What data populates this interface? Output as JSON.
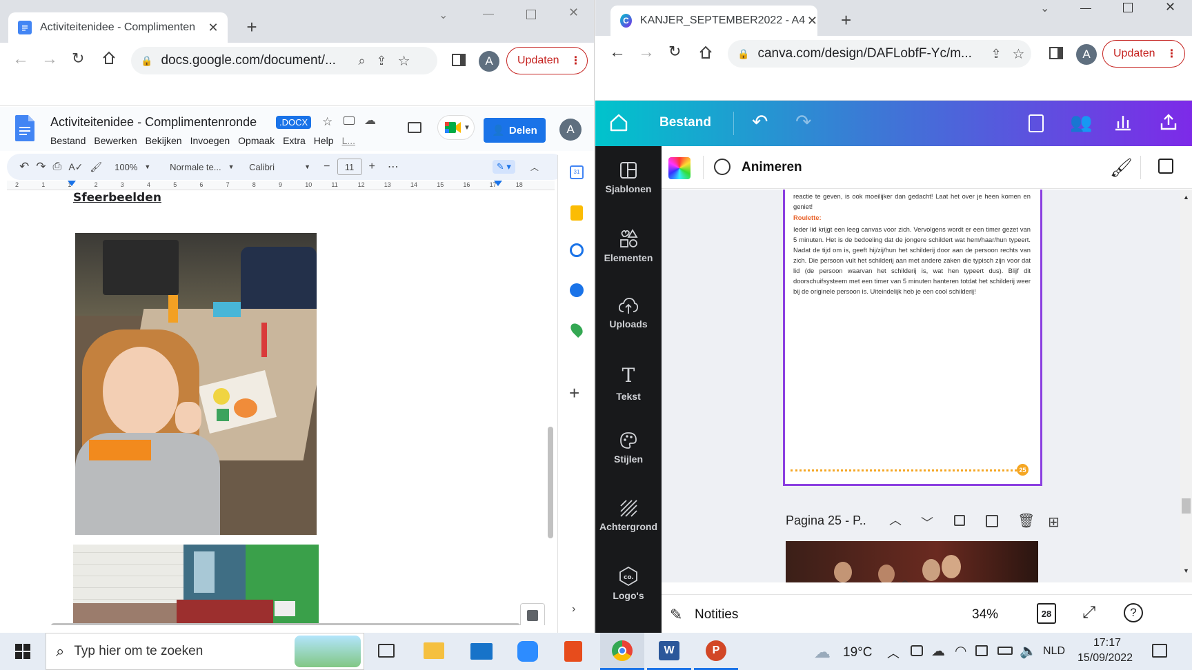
{
  "docs_window": {
    "tab_title": "Activiteitenidee - Complimenten",
    "url": "docs.google.com/document/...",
    "update_label": "Updaten",
    "profile_initial": "A",
    "doc_title": "Activiteitenidee - Complimentenronde",
    "doc_badge": ".DOCX",
    "menu": [
      "Bestand",
      "Bewerken",
      "Bekijken",
      "Invoegen",
      "Opmaak",
      "Extra",
      "Help",
      "L..."
    ],
    "share_label": "Delen",
    "toolbar": {
      "zoom": "100%",
      "style": "Normale te...",
      "font": "Calibri",
      "font_size": "11"
    },
    "ruler_numbers": [
      "2",
      "1",
      "1",
      "2",
      "3",
      "4",
      "5",
      "6",
      "7",
      "8",
      "9",
      "10",
      "11",
      "12",
      "13",
      "14",
      "15",
      "16",
      "17",
      "18"
    ],
    "heading": "Sfeerbeelden"
  },
  "canva_window": {
    "tab_title": "KANJER_SEPTEMBER2022 - A4",
    "url": "canva.com/design/DAFLobfF-Yc/m...",
    "update_label": "Updaten",
    "profile_initial": "A",
    "file_label": "Bestand",
    "animate_label": "Animeren",
    "sidebar": [
      "Sjablonen",
      "Elementen",
      "Uploads",
      "Tekst",
      "Stijlen",
      "Achtergrond",
      "Logo's"
    ],
    "page_text_top": "reactie te geven, is ook moeilijker dan gedacht! Laat het over je heen komen en geniet!",
    "section_title": "Roulette:",
    "section_body": "Ieder lid krijgt een leeg canvas voor zich. Vervolgens wordt er een timer gezet van 5 minuten. Het is de bedoeling dat de jongere schildert wat hem/haar/hun typeert. Nadat de tijd om is, geeft hij/zij/hun het schilderij door aan de persoon rechts van zich. Die persoon vult het schilderij aan met andere zaken die typisch zijn voor dat lid (de persoon waarvan het schilderij is, wat hen typeert dus). Blijf dit doorschuifsysteem met een timer van 5 minuten hanteren totdat het schilderij weer bij de originele persoon is. Uiteindelijk heb je een cool schilderij!",
    "page_number_badge": "25",
    "next_page_label": "Pagina 25 - P..",
    "notes_label": "Notities",
    "zoom": "34%",
    "page_count": "28"
  },
  "taskbar": {
    "search_placeholder": "Typ hier om te zoeken",
    "temperature": "19°C",
    "language": "NLD",
    "time": "17:17",
    "date": "15/09/2022"
  },
  "colors": {
    "canva_gradient_start": "#00c4cc",
    "canva_gradient_end": "#7d2ae8",
    "docs_blue": "#1a73e8",
    "orange_heading": "#e8642c",
    "page_border": "#8b3fe0"
  }
}
